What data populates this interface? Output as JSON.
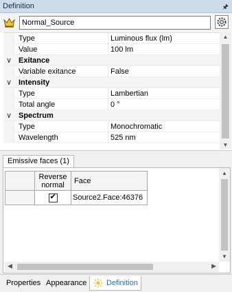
{
  "panel": {
    "title": "Definition",
    "pin_icon": "pin-icon"
  },
  "source": {
    "name": "Normal_Source",
    "source_icon": "crown-source-icon",
    "settings_icon": "gear-icon"
  },
  "properties": {
    "row_type": {
      "name": "Type",
      "value": "Luminous flux (lm)"
    },
    "row_value": {
      "name": "Value",
      "value": "100 lm"
    },
    "cat_exitance": {
      "label": "Exitance"
    },
    "row_variable_exitance": {
      "name": "Variable exitance",
      "value": "False"
    },
    "cat_intensity": {
      "label": "Intensity"
    },
    "row_intensity_type": {
      "name": "Type",
      "value": "Lambertian"
    },
    "row_total_angle": {
      "name": "Total angle",
      "value": "0 °"
    },
    "cat_spectrum": {
      "label": "Spectrum"
    },
    "row_spectrum_type": {
      "name": "Type",
      "value": "Monochromatic"
    },
    "row_wavelength": {
      "name": "Wavelength",
      "value": "525 nm"
    }
  },
  "emissive": {
    "tab_label": "Emissive faces (1)",
    "columns": {
      "reverse_normal": "Reverse normal",
      "face": "Face"
    },
    "rows": [
      {
        "reverse_normal": true,
        "face": "Source2.Face:46376"
      }
    ]
  },
  "bottom_tabs": {
    "properties": "Properties",
    "appearance": "Appearance",
    "definition": "Definition"
  },
  "colors": {
    "title_bar": "#cfdcec",
    "active_tab_text": "#1f6fbf",
    "panel_bg": "#f0f0f0"
  }
}
